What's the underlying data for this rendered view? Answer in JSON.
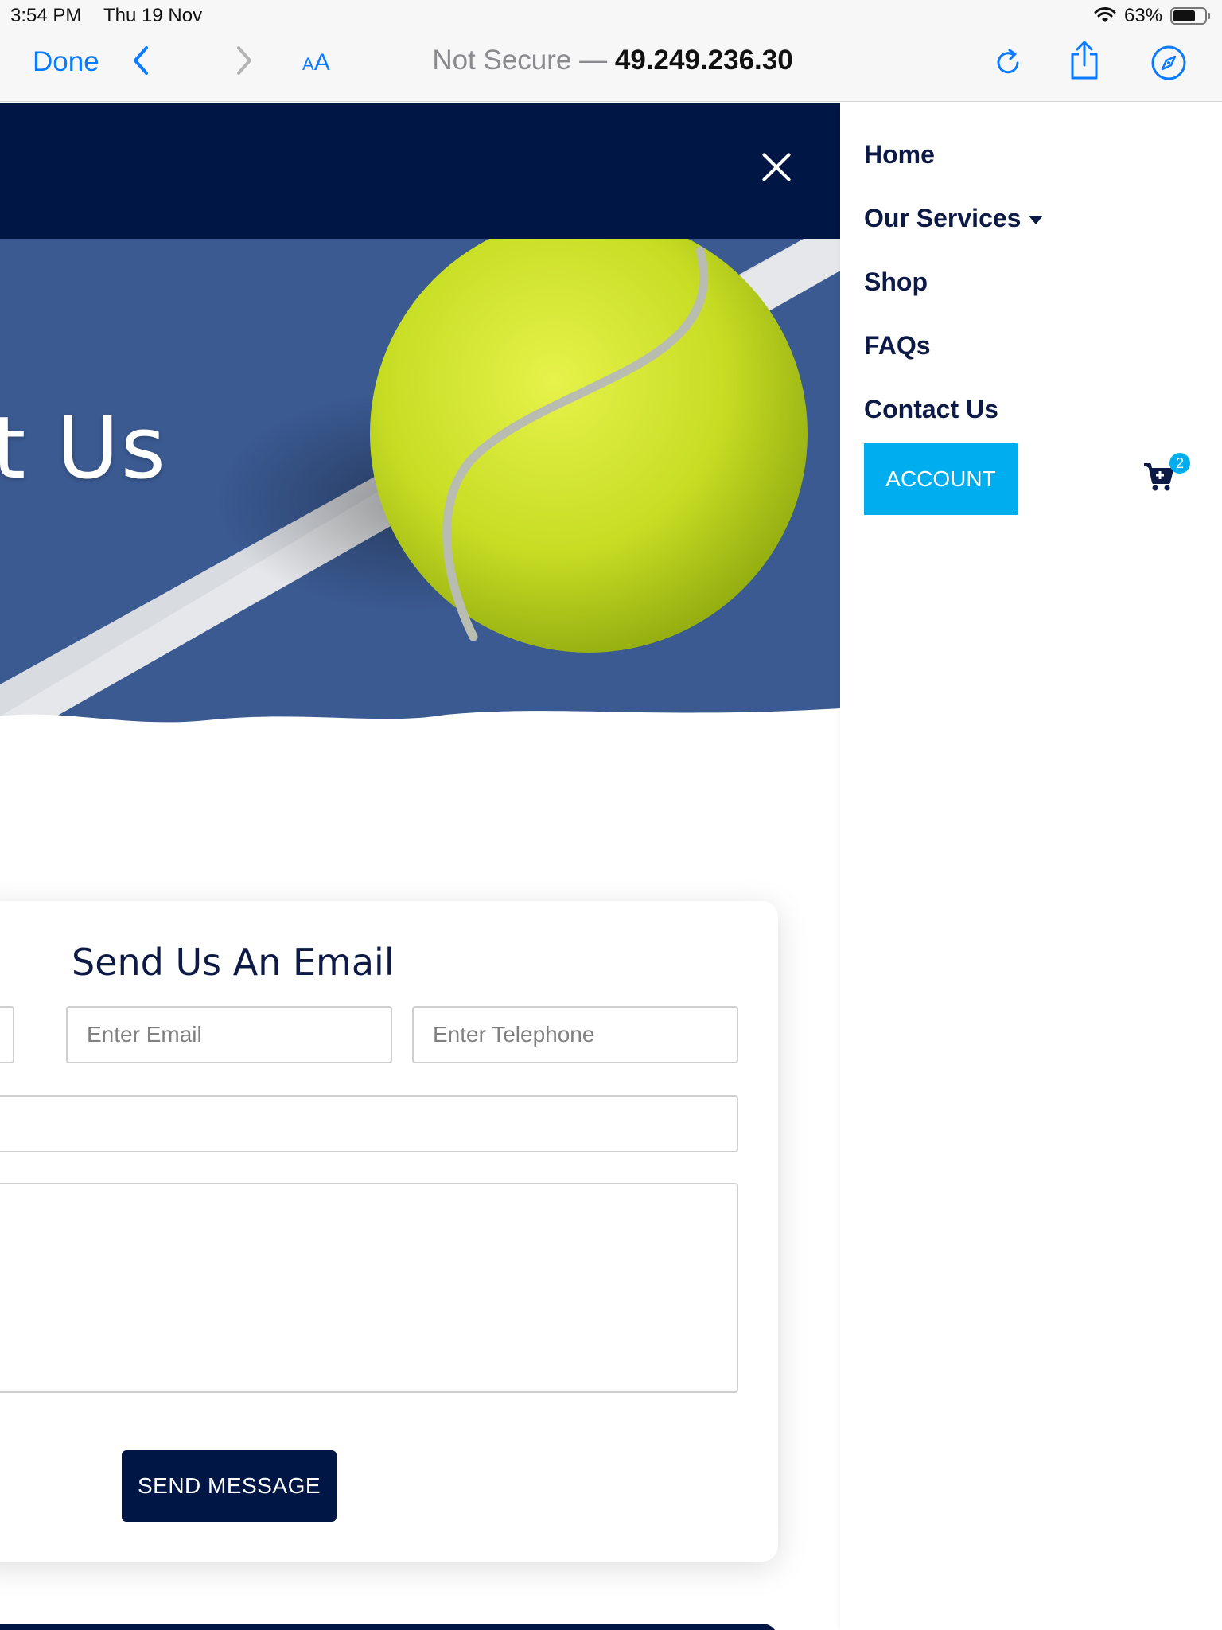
{
  "status_bar": {
    "time": "3:54 PM",
    "date": "Thu 19 Nov",
    "battery": "63%"
  },
  "toolbar": {
    "done_label": "Done",
    "aa_label_small": "A",
    "aa_label_large": "A",
    "address_prefix": "Not Secure —",
    "address_host": "49.249.236.30"
  },
  "hero": {
    "title_visible": "t Us"
  },
  "contact_form": {
    "title": "Send Us An Email",
    "email_placeholder": "Enter Email",
    "telephone_placeholder": "Enter Telephone",
    "submit_label": "SEND MESSAGE"
  },
  "nav": {
    "items": [
      {
        "label": "Home"
      },
      {
        "label": "Our Services"
      },
      {
        "label": "Shop"
      },
      {
        "label": "FAQs"
      },
      {
        "label": "Contact Us"
      }
    ],
    "account_label": "ACCOUNT",
    "cart_count": "2"
  },
  "icons": {
    "wifi": "wifi-icon",
    "battery": "battery-icon",
    "back": "chevron-left-icon",
    "forward": "chevron-right-icon",
    "reload": "reload-icon",
    "share": "share-icon",
    "compass": "compass-icon",
    "close": "close-icon",
    "cart": "cart-icon"
  },
  "colors": {
    "navy": "#001645",
    "accent_blue": "#00aeef",
    "ios_blue": "#0a7aff",
    "tennis_ball": "#c9e02c",
    "court_blue": "#3b5a92"
  }
}
